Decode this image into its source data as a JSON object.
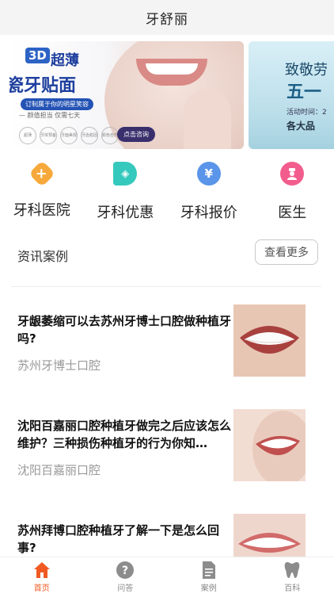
{
  "header": {
    "title": "牙舒丽"
  },
  "banner": {
    "slide1": {
      "badge": "3D",
      "title_line1": "超薄",
      "title_line2": "瓷牙贴面",
      "pill": "订制属于你的明星笑容",
      "sub": "— 颜值担当 仅需七天",
      "icons": [
        "超薄",
        "牙体预备少",
        "牙面美观",
        "牙齿稳固",
        "颜色自然"
      ],
      "button": "点击咨询"
    },
    "slide2": {
      "line1": "致敬劳",
      "line2": "五一",
      "line3": "活动时间：2",
      "line4": "各大品"
    }
  },
  "categories": [
    {
      "label": "牙科医院",
      "icon": "hospital-plus-icon",
      "color": "#f6a93a",
      "glyph": "+"
    },
    {
      "label": "牙科优惠",
      "icon": "discount-tag-icon",
      "color": "#35c9bd",
      "glyph": "◈"
    },
    {
      "label": "牙科报价",
      "icon": "yen-price-icon",
      "color": "#5b95ea",
      "glyph": "¥"
    },
    {
      "label": "医生",
      "icon": "doctor-icon",
      "color": "#f25d8e",
      "glyph": "●"
    }
  ],
  "section": {
    "title": "资讯案例",
    "more": "查看更多"
  },
  "articles": [
    {
      "title": "牙龈萎缩可以去苏州牙博士口腔做种植牙吗?",
      "source": "苏州牙博士口腔"
    },
    {
      "title": "沈阳百嘉丽口腔种植牙做完之后应该怎么维护？三种损伤种植牙的行为你知…",
      "source": "沈阳百嘉丽口腔"
    },
    {
      "title": "苏州拜博口腔种植牙了解一下是怎么回事?",
      "source": ""
    }
  ],
  "tabbar": [
    {
      "label": "首页",
      "icon": "home-icon",
      "active": true
    },
    {
      "label": "问答",
      "icon": "question-icon",
      "active": false
    },
    {
      "label": "案例",
      "icon": "document-icon",
      "active": false
    },
    {
      "label": "百科",
      "icon": "tooth-icon",
      "active": false
    }
  ],
  "colors": {
    "accent": "#f05a22",
    "inactive": "#888888"
  }
}
